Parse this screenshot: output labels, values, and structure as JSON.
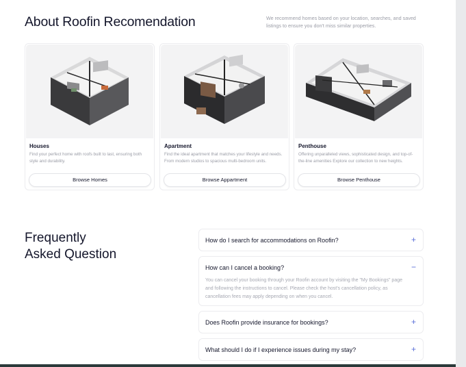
{
  "about": {
    "title": "About Roofin Recomendation",
    "description": "We recommend homes based on your location, searches, and saved listings to ensure you don't miss similar properties."
  },
  "cards": [
    {
      "title": "Houses",
      "description": "Find your perfect home with roofs built to last, ensuring both style and durability.",
      "button": "Browse Homes",
      "image": "house-floorplan-render"
    },
    {
      "title": "Apartment",
      "description": "Find the ideal apartment that matches your lifestyle and needs. From modern studios to spacious multi-bedroom units.",
      "button": "Browse Appartment",
      "image": "apartment-floorplan-render"
    },
    {
      "title": "Penthouse",
      "description": "Offering unparalleled views, sophisticated design, and top-of-the-line amenities Explore our collection to new heights.",
      "button": "Browse Penthouse",
      "image": "penthouse-floorplan-render"
    }
  ],
  "faq": {
    "title_line1": "Frequently",
    "title_line2": "Asked Question",
    "items": [
      {
        "question": "How do I search for accommodations on Roofin?",
        "toggle": "+",
        "expanded": false
      },
      {
        "question": "How can I cancel a booking?",
        "toggle": "−",
        "expanded": true,
        "answer": "You can cancel your booking through your Roofin account by visiting the \"My Bookings\" page and following the instructions to cancel. Please check the host's cancellation policy, as cancellation fees may apply depending on when you cancel."
      },
      {
        "question": "Does Roofin provide insurance for bookings?",
        "toggle": "+",
        "expanded": false
      },
      {
        "question": "What should I do if I experience issues during my stay?",
        "toggle": "+",
        "expanded": false
      }
    ]
  },
  "colors": {
    "accent": "#5a6fd8",
    "text": "#14162b",
    "muted": "#9a9ca6"
  }
}
